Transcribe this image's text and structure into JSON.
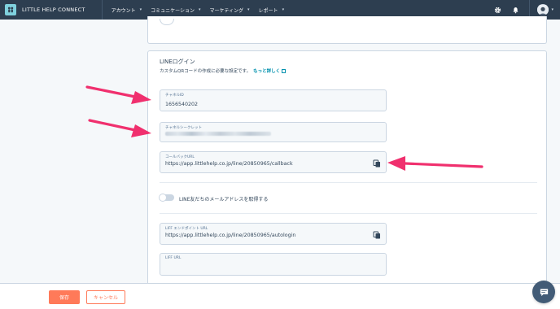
{
  "topbar": {
    "brand": "LITTLE HELP CONNECT",
    "nav": [
      {
        "label": "アカウント"
      },
      {
        "label": "コミュニケーション"
      },
      {
        "label": "マーケティング"
      },
      {
        "label": "レポート"
      }
    ],
    "icons": [
      "gear-icon",
      "bell-icon",
      "avatar"
    ]
  },
  "section": {
    "title": "LINEログイン",
    "description": "カスタムQRコードの作成に必要な設定です。",
    "more_link": "もっと詳しく"
  },
  "fields": {
    "channel_id": {
      "label": "チャネルID",
      "value": "1656540202"
    },
    "channel_secret": {
      "label": "チャネルシークレット",
      "value_masked": true
    },
    "callback_url": {
      "label": "コールバックURL",
      "value": "https://app.littlehelp.co.jp/line/20850965/callback"
    },
    "liff_endpoint": {
      "label": "LIFF エンドポイント URL",
      "value": "https://app.littlehelp.co.jp/line/20850965/autologin"
    },
    "liff_url": {
      "label": "LIFF URL",
      "value": ""
    }
  },
  "toggle": {
    "label": "LINE友だちのメールアドレスを取得する",
    "on": false
  },
  "footer": {
    "save": "保存",
    "cancel": "キャンセル"
  },
  "colors": {
    "accent": "#ff7a59",
    "nav_bg": "#2d3e50",
    "link": "#0091ae",
    "annotation_arrow": "#f0306e"
  }
}
